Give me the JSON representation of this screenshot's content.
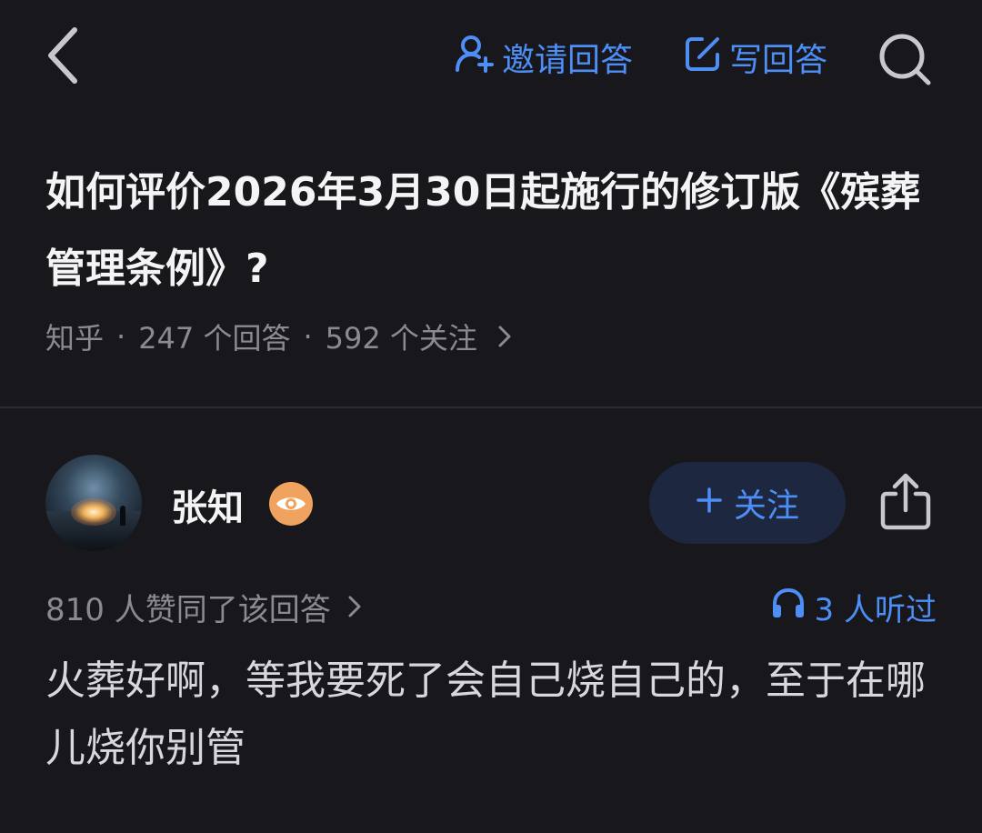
{
  "topbar": {
    "back_icon": "chevron-left-icon",
    "invite_label": "邀请回答",
    "invite_icon": "person-add-icon",
    "write_label": "写回答",
    "write_icon": "edit-icon",
    "search_icon": "search-icon"
  },
  "question": {
    "title": "如何评价2026年3月30日起施行的修订版《殡葬管理条例》?",
    "source": "知乎",
    "answers": "247 个回答",
    "followers": "592 个关注",
    "separator": "·"
  },
  "answer": {
    "author": "张知",
    "badge_icon": "eye-badge-icon",
    "follow_label": "关注",
    "follow_icon": "plus-icon",
    "share_icon": "share-icon",
    "upvotes": "810 人赞同了该回答",
    "listen_label": "3 人听过",
    "listen_icon": "headphones-icon",
    "content": "火葬好啊，等我要死了会自己烧自己的，至于在哪儿烧你别管"
  },
  "colors": {
    "background": "#18181c",
    "accent": "#4d8ef7",
    "muted": "#8a8b92",
    "badge": "#f0a35e",
    "follow_bg": "#1d2840"
  }
}
